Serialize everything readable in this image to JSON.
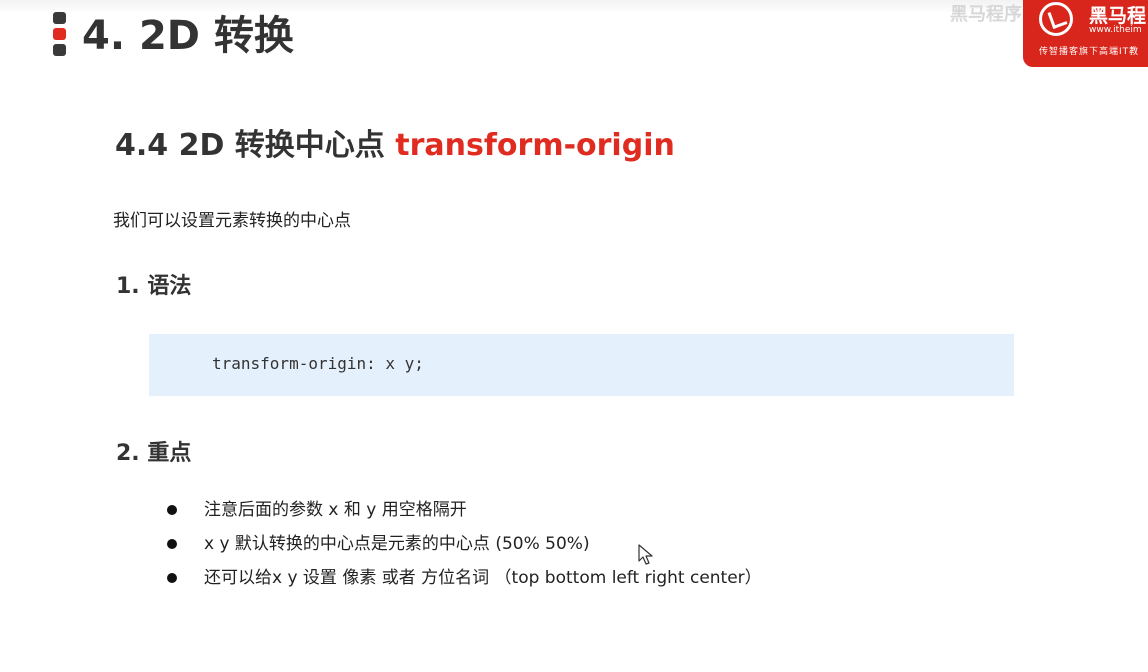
{
  "chapter": {
    "title": "4. 2D 转换"
  },
  "brand": {
    "logo_icon": "horse-logo-icon",
    "name": "黑马程",
    "url": "www.itheim",
    "slogan": "传智播客旗下高端IT教"
  },
  "watermark": "黑马程序员",
  "section": {
    "title_prefix": "4.4 2D 转换中心点 ",
    "title_accent": "transform-origin",
    "accent_color": "#e02b20",
    "intro": "我们可以设置元素转换的中心点"
  },
  "syntax": {
    "heading": "1. 语法",
    "code": "transform-origin: x y;",
    "code_bg": "#e5f0fd"
  },
  "key_points": {
    "heading": "2. 重点",
    "items": [
      "注意后面的参数 x 和 y 用空格隔开",
      "x y 默认转换的中心点是元素的中心点 (50%  50%)",
      "还可以给x y 设置 像素 或者  方位名词  （top  bottom  left  right  center）"
    ]
  }
}
